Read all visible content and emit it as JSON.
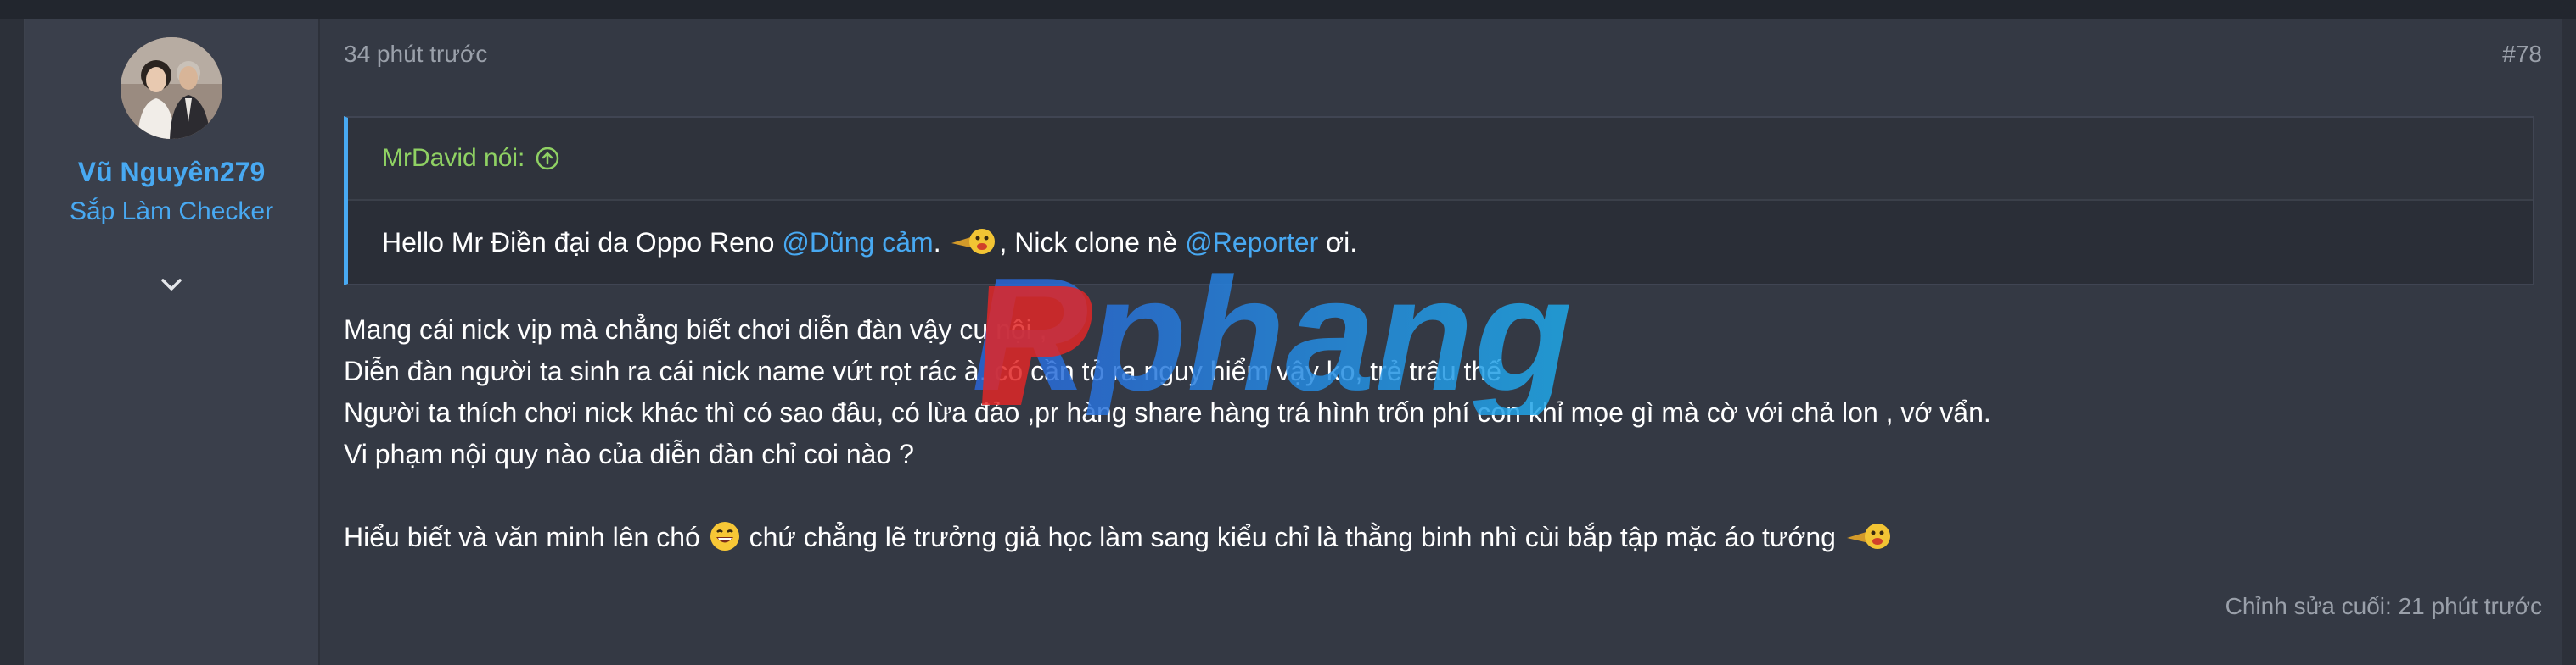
{
  "user": {
    "name": "Vũ Nguyên279",
    "title": "Sắp Làm Checker"
  },
  "post": {
    "timestamp": "34 phút trước",
    "number": "#78",
    "quote": {
      "author": "MrDavid nói:",
      "text_before": "Hello Mr Điền đại da Oppo Reno ",
      "mention1": "@Dũng cảm",
      "text_middle": ".",
      "text_after_emoji": ", Nick clone nè ",
      "mention2": "@Reporter",
      "text_end": " ơi."
    },
    "lines": [
      "Mang cái nick vịp mà chẳng biết chơi diễn đàn vậy cụ nội ,",
      "Diễn đàn người ta sinh ra cái nick name vứt rọt rác à. có cần tỏ ra nguy hiểm vậy ko, trẻ trâu thế",
      "Người ta thích chơi nick khác thì có sao đâu, có lừa đảo ,pr hàng share hàng trá hình trốn phí con khỉ mọe gì mà cờ với chả lon , vớ vẩn.",
      "Vi phạm nội quy nào của diễn đàn chỉ coi nào ?"
    ],
    "final_line_before_emoji": "Hiểu biết và văn minh lên chó ",
    "final_line_after_emoji": " chứ chẳng lẽ trưởng giả học làm sang kiểu chỉ là thằng binh nhì cùi bắp tập mặc áo tướng ",
    "edited": "Chỉnh sửa cuối: 21 phút trước"
  },
  "watermark": "Rphang",
  "icons": {
    "expand": "chevron-down-icon",
    "quote_jump": "arrow-up-circle-icon"
  },
  "colors": {
    "accent": "#48a9f2",
    "quote_author": "#8fd163",
    "background": "#2c3039"
  }
}
